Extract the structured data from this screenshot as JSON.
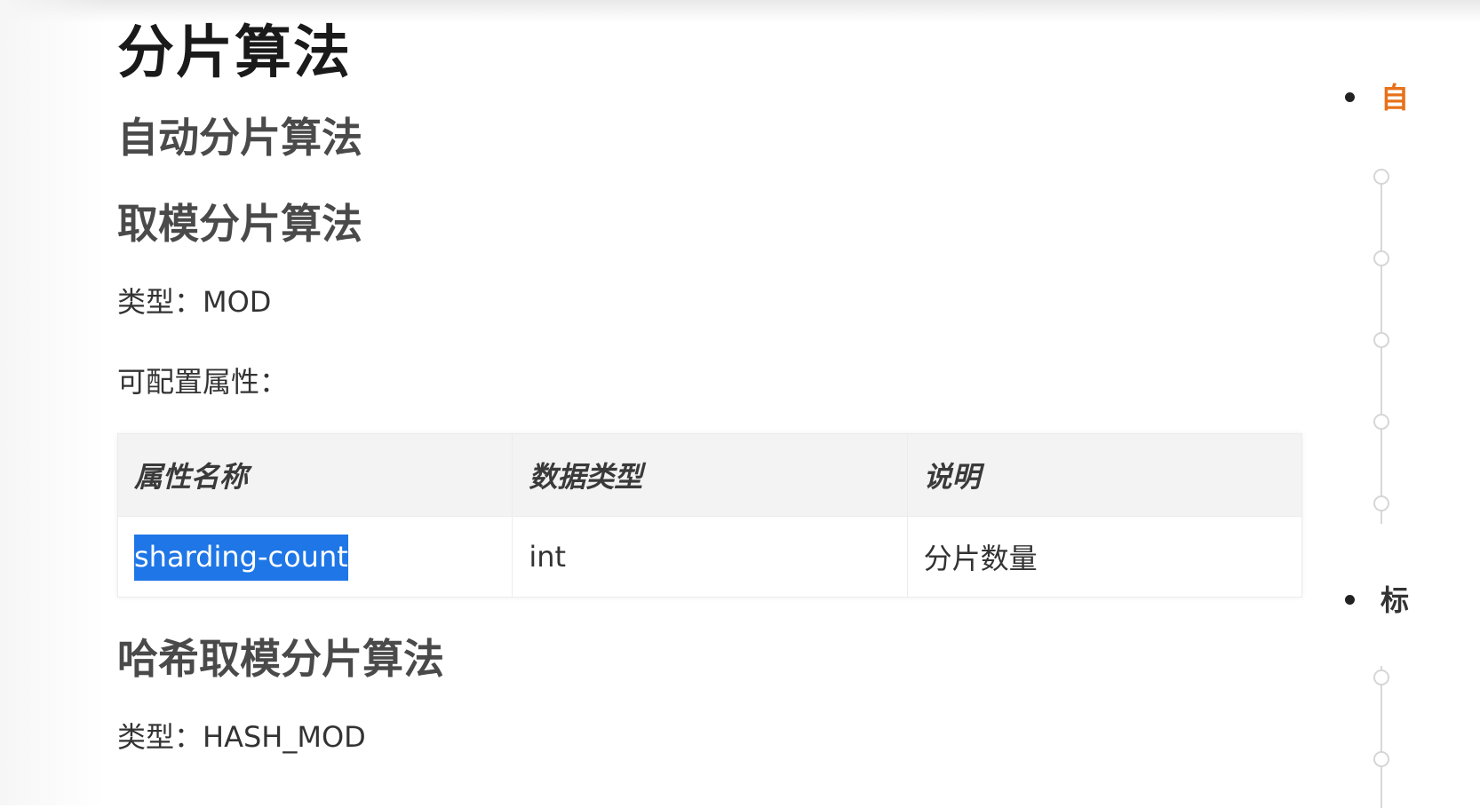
{
  "doc": {
    "title": "分片算法",
    "sections": {
      "auto": "自动分片算法",
      "mod": "取模分片算法",
      "hash_mod": "哈希取模分片算法"
    },
    "mod_type": "类型：MOD",
    "configurable": "可配置属性：",
    "table": {
      "headers": [
        "属性名称",
        "数据类型",
        "说明"
      ],
      "rows": [
        [
          "sharding-count",
          "int",
          "分片数量"
        ]
      ]
    },
    "hash_mod_type": "类型：HASH_MOD"
  },
  "toc": {
    "items": [
      {
        "text": "自",
        "color": "#e8711a"
      },
      {
        "text": "标",
        "color": "#333333"
      }
    ]
  },
  "colors": {
    "selection": "#1f76e6",
    "heading": "#4a4a4a",
    "toc_accent": "#e8711a"
  }
}
